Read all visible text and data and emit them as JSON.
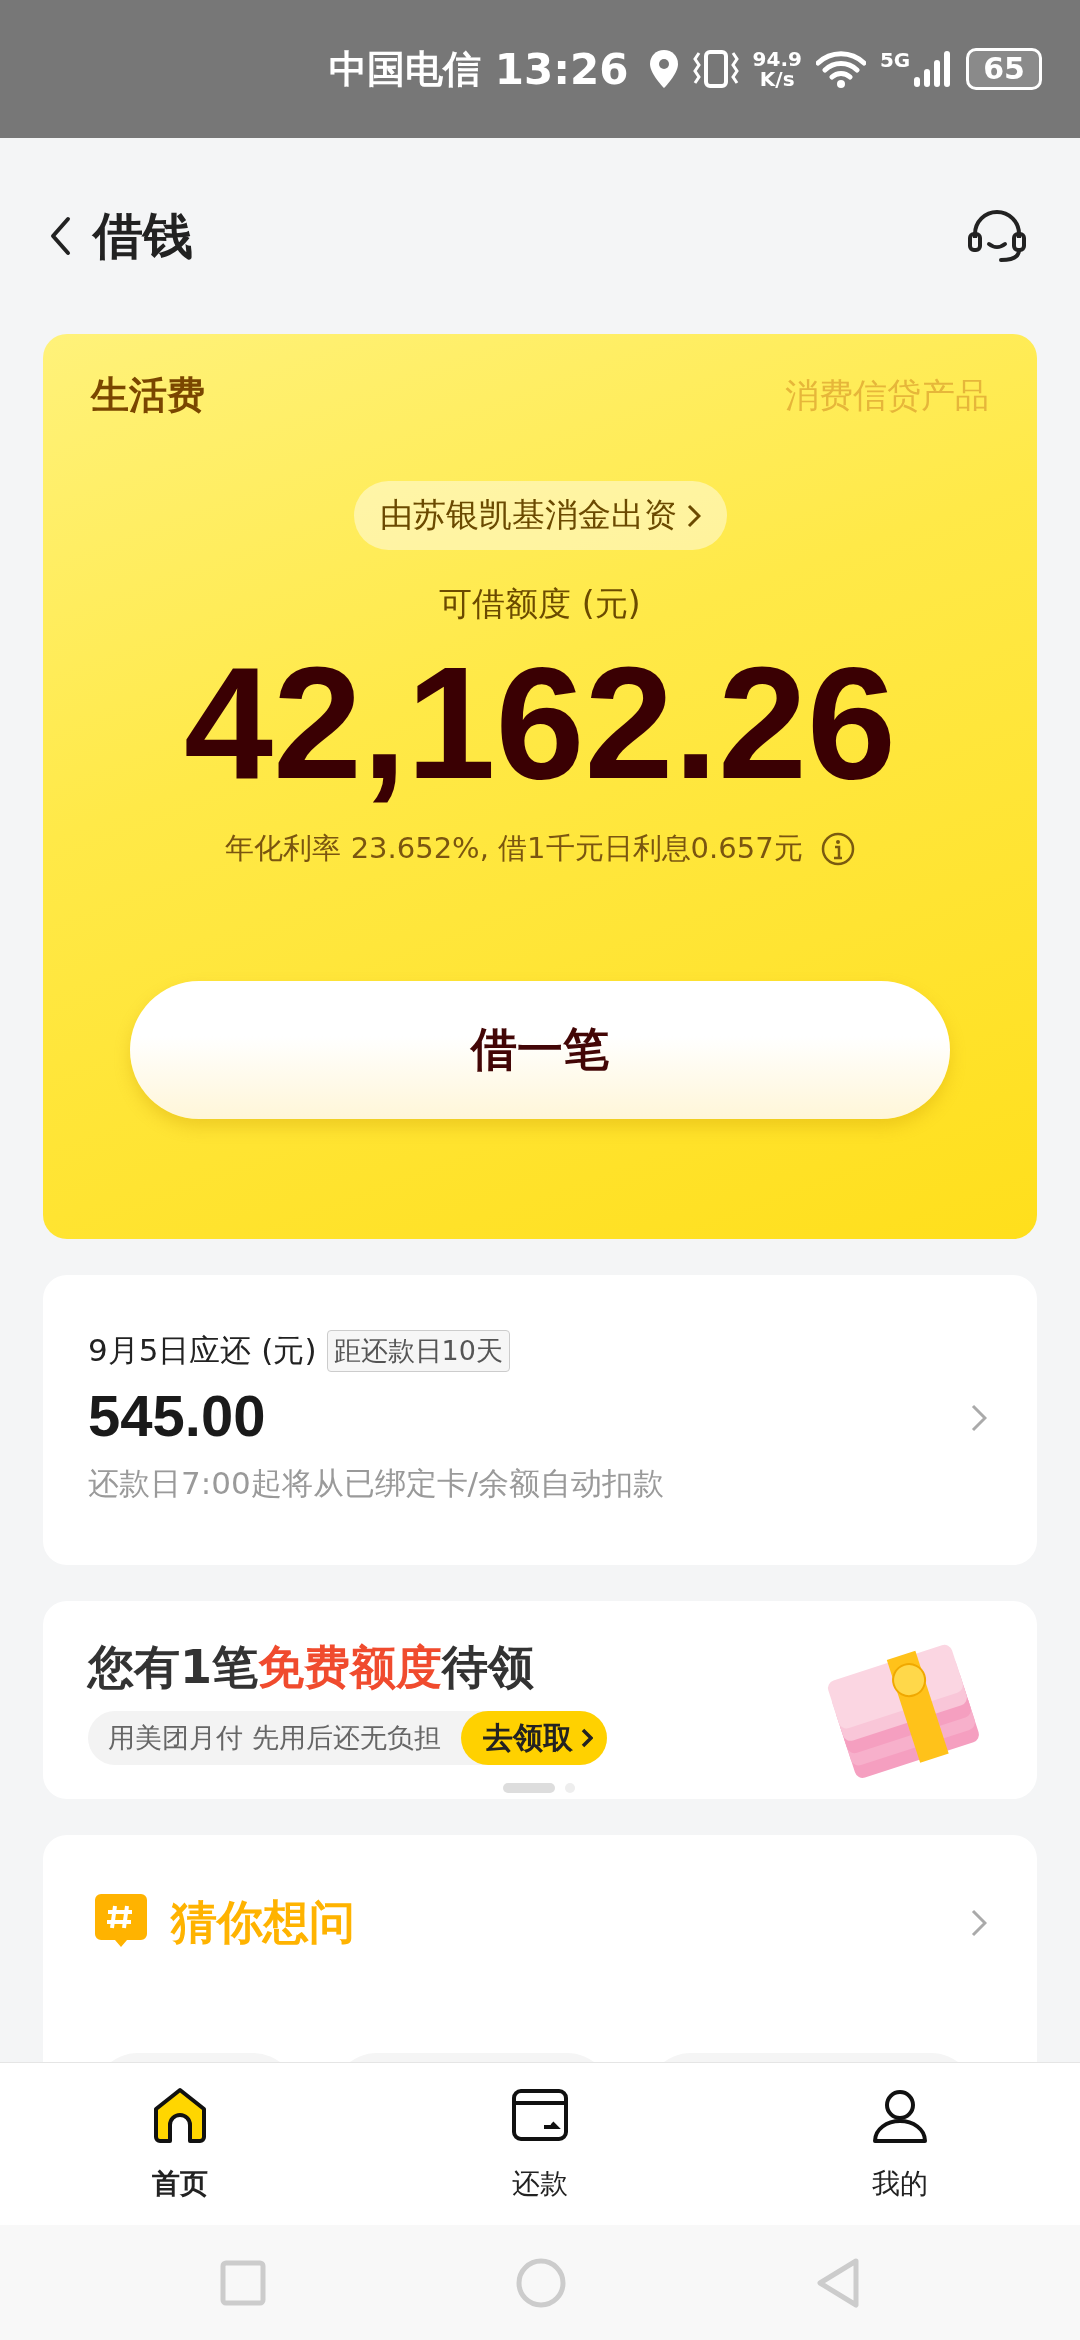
{
  "status_bar": {
    "carrier": "中国电信",
    "time": "13:26",
    "speed_value": "94.9",
    "speed_unit": "K/s",
    "network": "5G",
    "battery": "65"
  },
  "header": {
    "title": "借钱"
  },
  "credit_card": {
    "title": "生活费",
    "tag": "消费信贷产品",
    "funder": "由苏银凯基消金出资",
    "limit_label": "可借额度 (元)",
    "amount": "42,162.26",
    "rate_text": "年化利率 23.652%, 借1千元日利息0.657元",
    "button": "借一笔"
  },
  "bill": {
    "title": "9月5日应还 (元)",
    "countdown": "距还款日10天",
    "amount": "545.00",
    "note": "还款日7:00起将从已绑定卡/余额自动扣款"
  },
  "promo": {
    "headline": [
      {
        "text": "您有1笔",
        "highlight": false
      },
      {
        "text": "免费额度",
        "highlight": true
      },
      {
        "text": "待领",
        "highlight": false
      }
    ],
    "subtitle": "用美团月付 先用后还无负担",
    "button": "去领取",
    "pages": [
      {
        "selected": true
      },
      {
        "selected": false
      }
    ]
  },
  "faq": {
    "title": "猜你想问",
    "chips": [
      {
        "kind": "chip"
      },
      {
        "kind": "chip"
      },
      {
        "kind": "chip"
      }
    ]
  },
  "tab_bar": [
    {
      "kind": "home",
      "label": "首页",
      "selected": true
    },
    {
      "kind": "repay",
      "label": "还款",
      "selected": false
    },
    {
      "kind": "me",
      "label": "我的",
      "selected": false
    }
  ]
}
